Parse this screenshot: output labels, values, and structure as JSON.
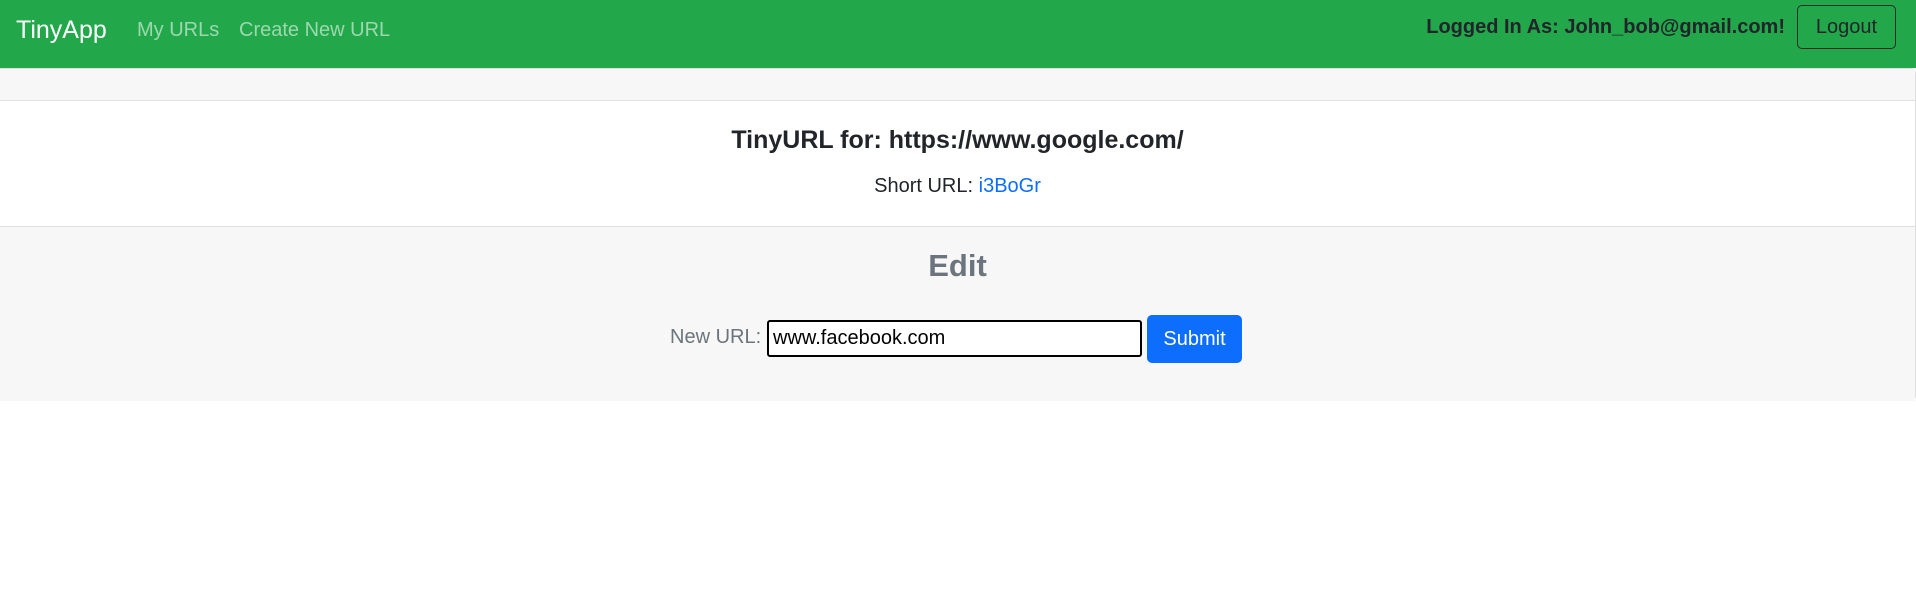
{
  "navbar": {
    "brand": "TinyApp",
    "links": [
      "My URLs",
      "Create New URL"
    ],
    "logged_in_text": "Logged In As: John_bob@gmail.com!",
    "logout_label": "Logout",
    "background_color": "#22a84b"
  },
  "url_card": {
    "title": "TinyURL for: https://www.google.com/",
    "short_url_label": "Short URL:",
    "short_url_value": "i3BoGr"
  },
  "edit_form": {
    "heading": "Edit",
    "field_label": "New URL:",
    "field_value": "www.facebook.com",
    "submit_label": "Submit",
    "submit_color": "#0d6efd"
  }
}
